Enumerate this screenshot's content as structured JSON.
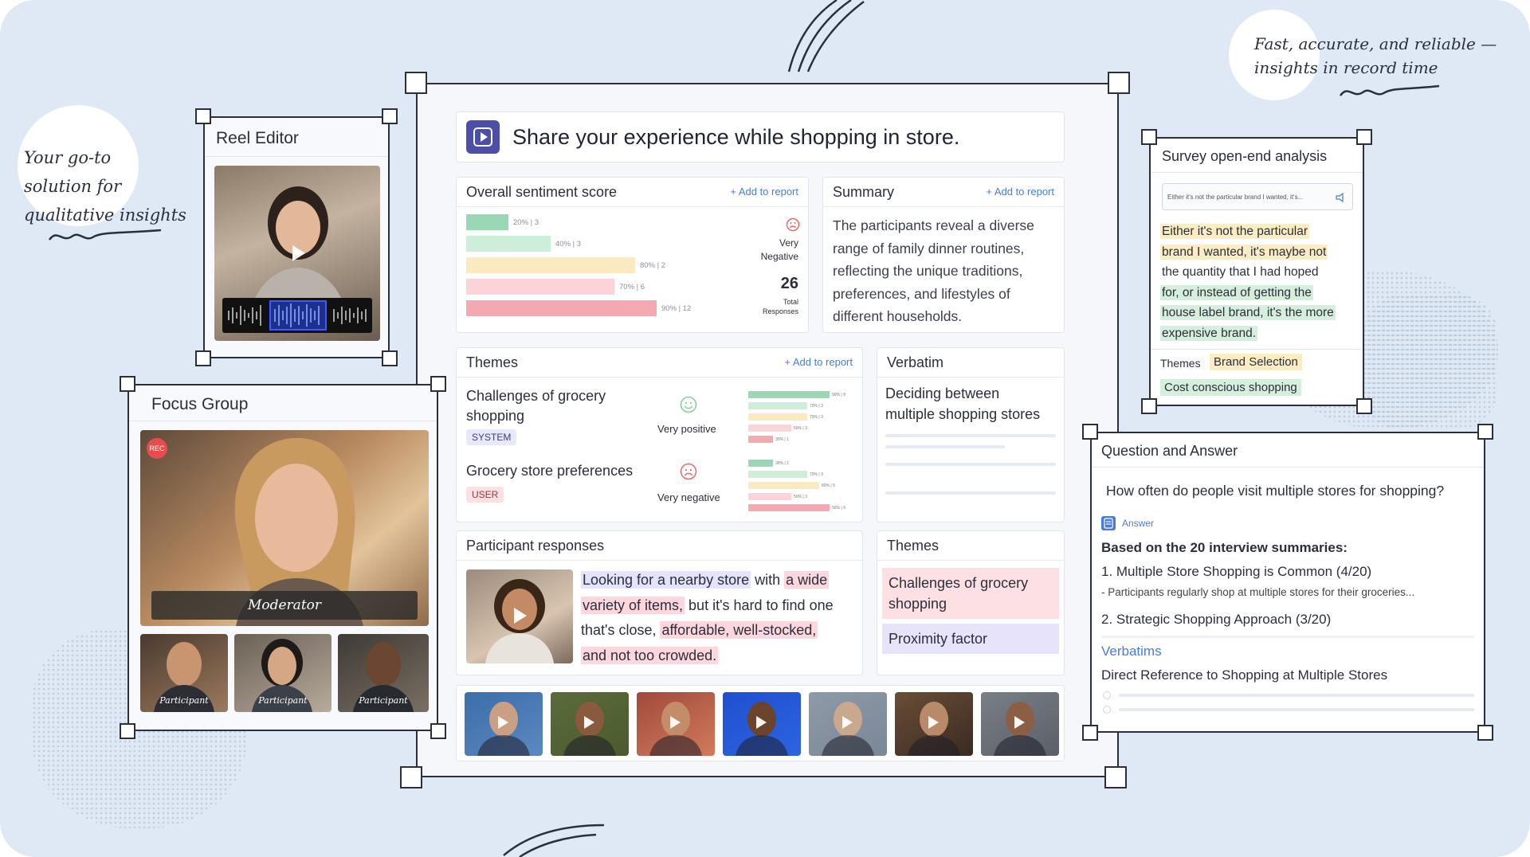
{
  "tagline_left": {
    "line1": "Your go-to",
    "line2": "solution for",
    "line3": "qualitative insights"
  },
  "tagline_right": {
    "line1": "Fast, accurate, and reliable —",
    "line2": "insights in record time"
  },
  "reel_editor": {
    "title": "Reel Editor"
  },
  "focus_group": {
    "title": "Focus Group",
    "rec_badge": "REC",
    "moderator_label": "Moderator",
    "participants": [
      "Participant",
      "Participant",
      "Participant"
    ]
  },
  "main": {
    "question": "Share your experience while shopping in store.",
    "sentiment": {
      "title": "Overall sentiment score",
      "add_label": "+ Add to report",
      "bars": [
        {
          "label": "20% | 3",
          "value": 20,
          "color": "#9ad8b5"
        },
        {
          "label": "40% | 3",
          "value": 40,
          "color": "#cdeed8"
        },
        {
          "label": "80% | 2",
          "value": 80,
          "color": "#fbeac0"
        },
        {
          "label": "70% | 6",
          "value": 70,
          "color": "#fbd3d8"
        },
        {
          "label": "90% | 12",
          "value": 90,
          "color": "#f4a8b0"
        }
      ],
      "sentiment_label_1": "Very",
      "sentiment_label_2": "Negative",
      "total_value": "26",
      "total_label_1": "Total",
      "total_label_2": "Responses"
    },
    "summary": {
      "title": "Summary",
      "add_label": "+ Add to report",
      "text": "The participants reveal a diverse range of family dinner routines, reflecting the unique traditions, preferences, and lifestyles of different households."
    },
    "themes": {
      "title": "Themes",
      "add_label": "+ Add to report",
      "items": [
        {
          "name_1": "Challenges of grocery",
          "name_2": "shopping",
          "tag": "SYSTEM",
          "sentiment": "Very positive",
          "bars": [
            {
              "label": "90% | 9",
              "value": 85,
              "color": "#9ad8b5"
            },
            {
              "label": "70% | 3",
              "value": 62,
              "color": "#cdeed8"
            },
            {
              "label": "70% | 3",
              "value": 62,
              "color": "#fbeac0"
            },
            {
              "label": "50% | 3",
              "value": 45,
              "color": "#fbd3d8"
            },
            {
              "label": "30% | 1",
              "value": 26,
              "color": "#f4a8b0"
            }
          ]
        },
        {
          "name_1": "Grocery store preferences",
          "name_2": "",
          "tag": "USER",
          "sentiment": "Very negative",
          "bars": [
            {
              "label": "30% | 1",
              "value": 26,
              "color": "#9ad8b5"
            },
            {
              "label": "70% | 3",
              "value": 62,
              "color": "#cdeed8"
            },
            {
              "label": "80% | 5",
              "value": 74,
              "color": "#fbeac0"
            },
            {
              "label": "50% | 3",
              "value": 45,
              "color": "#fbd3d8"
            },
            {
              "label": "90% | 9",
              "value": 85,
              "color": "#f4a8b0"
            }
          ]
        }
      ]
    },
    "verbatim": {
      "title": "Verbatim",
      "text_1": "Deciding between",
      "text_2": "multiple shopping stores"
    },
    "participant_responses": {
      "title": "Participant responses",
      "segments": [
        "Looking for a nearby store",
        " with ",
        "a wide",
        "variety of items,",
        " but it's hard to find one",
        "that's close, ",
        "affordable, well-stocked,",
        "and not too crowded."
      ]
    },
    "themes2": {
      "title": "Themes",
      "item_1": "Challenges of grocery shopping",
      "item_2": "Proximity factor"
    }
  },
  "survey": {
    "title": "Survey open-end analysis",
    "input_value": "Either it's not the particular brand I wanted, it's...",
    "lines": [
      "Either it's not the particular",
      "brand I wanted, it's maybe not",
      "the quantity that I had hoped",
      "for, or instead of getting the",
      "house label brand, it's the more",
      "expensive brand."
    ],
    "themes_label": "Themes",
    "theme_1": "Brand Selection",
    "theme_2": "Cost conscious shopping"
  },
  "qa": {
    "title": "Question and Answer",
    "question": "How often do people visit multiple stores for shopping?",
    "answer_label": "Answer",
    "based_on": "Based on the 20 interview summaries:",
    "point_1": "1. Multiple Store Shopping is Common (4/20)",
    "point_1_sub": "- Participants regularly shop at multiple stores for their groceries...",
    "point_2": "2. Strategic Shopping Approach (3/20)",
    "verbatims_label": "Verbatims",
    "verbatim_text": "Direct Reference to Shopping at Multiple Stores"
  },
  "colors": {
    "accent": "#4a7bd8",
    "icon_purple": "#4b4fa8",
    "outline": "#2b2f3a",
    "background": "#dfe9f5"
  }
}
